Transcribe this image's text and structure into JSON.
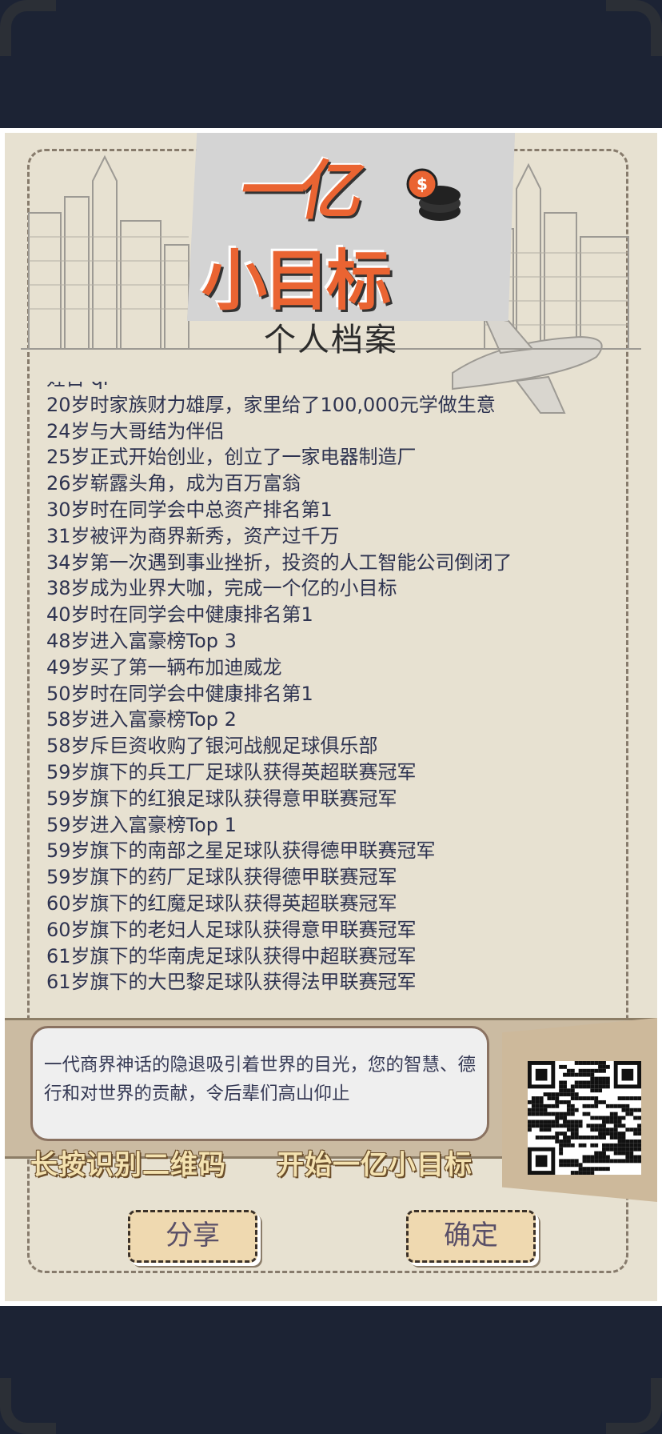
{
  "logo": {
    "line1": "一亿",
    "line2": "小目标"
  },
  "title": "个人档案",
  "partial_top_line": "妊百 qi",
  "events": [
    "20岁时家族财力雄厚，家里给了100,000元学做生意",
    "24岁与大哥结为伴侣",
    "25岁正式开始创业，创立了一家电器制造厂",
    "26岁崭露头角，成为百万富翁",
    "30岁时在同学会中总资产排名第1",
    "31岁被评为商界新秀，资产过千万",
    "34岁第一次遇到事业挫折，投资的人工智能公司倒闭了",
    "38岁成为业界大咖，完成一个亿的小目标",
    "40岁时在同学会中健康排名第1",
    "48岁进入富豪榜Top 3",
    "49岁买了第一辆布加迪威龙",
    "50岁时在同学会中健康排名第1",
    "58岁进入富豪榜Top 2",
    "58岁斥巨资收购了银河战舰足球俱乐部",
    "59岁旗下的兵工厂足球队获得英超联赛冠军",
    "59岁旗下的红狼足球队获得意甲联赛冠军",
    "59岁进入富豪榜Top 1",
    "59岁旗下的南部之星足球队获得德甲联赛冠军",
    "59岁旗下的药厂足球队获得德甲联赛冠军",
    "60岁旗下的红魔足球队获得英超联赛冠军",
    "60岁旗下的老妇人足球队获得意甲联赛冠军",
    "61岁旗下的华南虎足球队获得中超联赛冠军",
    "61岁旗下的大巴黎足球队获得法甲联赛冠军"
  ],
  "message": "一代商界神话的隐退吸引着世界的目光，您的智慧、德行和对世界的贡献，令后辈们高山仰止",
  "promo_left": "长按识别二维码",
  "promo_right": "开始一亿小目标",
  "buttons": {
    "share": "分享",
    "confirm": "确定"
  },
  "colors": {
    "accent": "#ea6432",
    "paper": "#e7e1d1",
    "button": "#efd9b0",
    "background": "#1c2334"
  }
}
